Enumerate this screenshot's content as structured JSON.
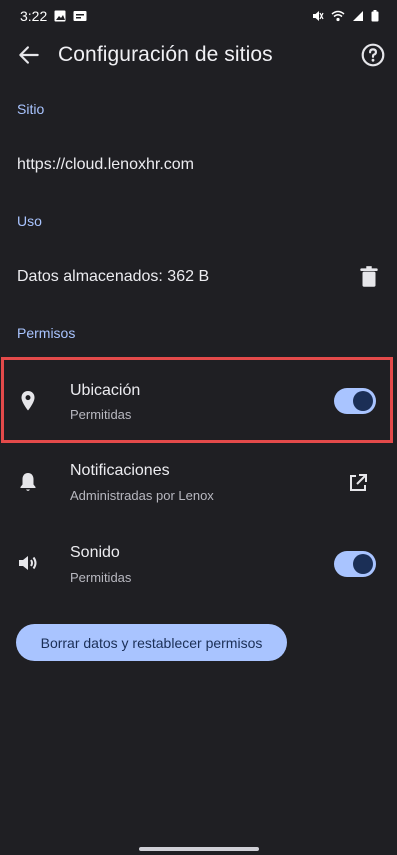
{
  "status_bar": {
    "time": "3:22"
  },
  "header": {
    "title": "Configuración de sitios"
  },
  "site_section": {
    "label": "Sitio",
    "url": "https://cloud.lenoxhr.com"
  },
  "usage_section": {
    "label": "Uso",
    "stored_data": "Datos almacenados: 362 B"
  },
  "permissions_section": {
    "label": "Permisos",
    "items": [
      {
        "title": "Ubicación",
        "subtitle": "Permitidas",
        "icon": "location-pin-icon",
        "toggle_on": true
      },
      {
        "title": "Notificaciones",
        "subtitle": "Administradas por Lenox",
        "icon": "bell-icon"
      },
      {
        "title": "Sonido",
        "subtitle": "Permitidas",
        "icon": "speaker-icon",
        "toggle_on": true
      }
    ]
  },
  "actions": {
    "reset_button": "Borrar datos y restablecer permisos"
  },
  "colors": {
    "background": "#1f1f23",
    "accent": "#a9c4ff",
    "highlight": "#e34a4a"
  }
}
